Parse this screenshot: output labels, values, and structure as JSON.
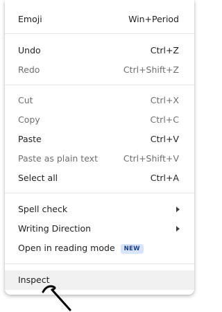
{
  "menu": {
    "emoji": {
      "label": "Emoji",
      "shortcut": "Win+Period"
    },
    "undo": {
      "label": "Undo",
      "shortcut": "Ctrl+Z"
    },
    "redo": {
      "label": "Redo",
      "shortcut": "Ctrl+Shift+Z"
    },
    "cut": {
      "label": "Cut",
      "shortcut": "Ctrl+X"
    },
    "copy": {
      "label": "Copy",
      "shortcut": "Ctrl+C"
    },
    "paste": {
      "label": "Paste",
      "shortcut": "Ctrl+V"
    },
    "paste_plain": {
      "label": "Paste as plain text",
      "shortcut": "Ctrl+Shift+V"
    },
    "select_all": {
      "label": "Select all",
      "shortcut": "Ctrl+A"
    },
    "spell_check": {
      "label": "Spell check"
    },
    "writing_direction": {
      "label": "Writing Direction"
    },
    "reading_mode": {
      "label": "Open in reading mode",
      "badge": "NEW"
    },
    "inspect": {
      "label": "Inspect"
    }
  },
  "colors": {
    "text": "#1f1f1f",
    "disabled_text": "#6e6e6e",
    "badge_bg": "#d8e4fb",
    "badge_text": "#1a3c86",
    "hover_bg": "#f0f0f0"
  }
}
